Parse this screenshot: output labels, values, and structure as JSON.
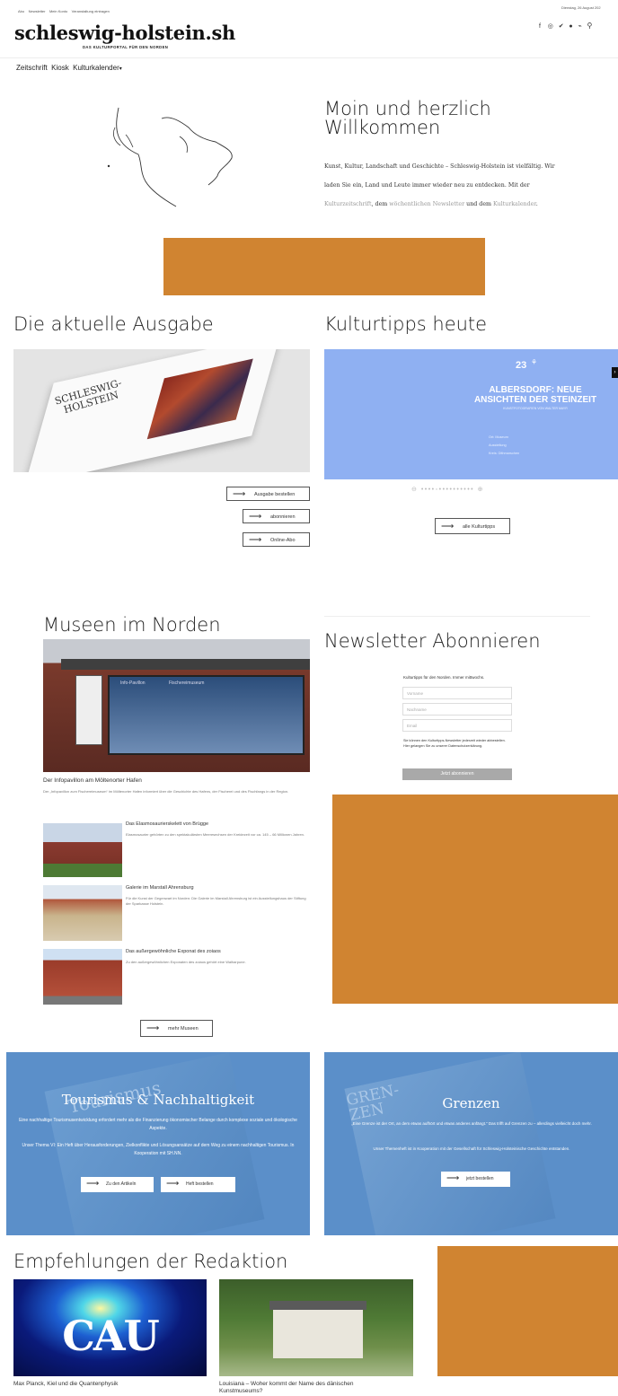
{
  "topbar": {
    "links": [
      "Abo",
      "Newsletter",
      "Mein Konto",
      "Veranstaltung eintragen"
    ],
    "date": "Dienstag, 26 August 202"
  },
  "header": {
    "logo": "schleswig-holstein.sh",
    "tagline": "DAS KULTURPORTAL FÜR DEN NORDEN",
    "social_icons": [
      "facebook-icon",
      "instagram-icon",
      "twitter-icon",
      "podcast-icon",
      "rss-icon",
      "search-icon"
    ]
  },
  "nav": {
    "items": [
      "Zeitschrift",
      "Kiosk",
      "Kulturkalender"
    ]
  },
  "welcome": {
    "title_line1": "Moin und herzlich",
    "title_line2": "Willkommen",
    "text1": "Kunst, Kultur, Landschaft und Geschichte – Schleswig-Holstein ist vielfältig. Wir",
    "text2": "laden Sie ein, Land und Leute immer wieder neu zu entdecken. Mit der",
    "link1": "Kulturzeitschrift",
    "sep1": ", dem ",
    "link2": "wöchentlichen Newsletter",
    "sep2": " und dem ",
    "link3": "Kulturkalender",
    "end": "."
  },
  "ausgabe": {
    "heading": "Die aktuelle Ausgabe",
    "magazine_title": "SCHLESWIG-HOLSTEIN",
    "buttons": [
      "Ausgabe bestellen",
      "abonnieren",
      "Online-Abo"
    ]
  },
  "kulturtipps": {
    "heading": "Kulturtipps heute",
    "day": "23",
    "headline1": "ALBERSDORF: NEUE",
    "headline2": "ANSICHTEN DER STEINZEIT",
    "sub": "KUNSTFOTOGRAFIEN VON WALTER MAYR",
    "meta1": "Ort: Museum",
    "meta2": "Ausstellung",
    "meta3": "Kreis: Dithmarschen",
    "button": "alle Kulturtipps",
    "accent": "#8fb0f2"
  },
  "museen": {
    "heading": "Museen im Norden",
    "photo_labels": [
      "Info-Pavillon",
      "Fischereimuseum"
    ],
    "main_title": "Der Infopavillon am Möltenorter Hafen",
    "main_text": "Der „Infopavillon zum Fischereimuseum“ im Möltenorter Hafen informiert über die Geschichte des Hafens, der Fischerei und des Fischfangs in der Region.",
    "items": [
      {
        "title": "Das Elasmosaurierskelett von Brügge",
        "text": "Elasmosaurier gehörten zu den spektakulärsten Meeresechsen der Kreidezeit vor ca. 145 – 66 Millionen Jahren."
      },
      {
        "title": "Galerie im Marstall Ahrensburg",
        "text": "Für die Kunst der Gegenwart im Norden: Die Galerie im Marstall Ahrensburg ist ein Ausstellungshaus der Stiftung der Sparkasse Holstein."
      },
      {
        "title": "Das außergewöhnliche Exponat des zoiaos",
        "text": "Zu den außergewöhnlichen Exponaten des zoiaos gehört eine Walharpune."
      }
    ],
    "button": "mehr Museen"
  },
  "newsletter": {
    "heading": "Newsletter Abonnieren",
    "intro": "Kulturtipps für den Norden. Immer mittwochs.",
    "fields": [
      "Vorname",
      "Nachname",
      "Email"
    ],
    "legal": "Sie können den Kulturtipps-Newsletter jederzeit wieder abbestellen. Hier gelangen Sie zu unserer Datenschutzerklärung.",
    "submit": "Jetzt abonnieren"
  },
  "tourismus": {
    "title": "Tourismus & Nachhaltigkeit",
    "text1": "Eine nachhaltige Tourismusentwicklung erfordert mehr als die Finanzierung ökonomischer Belange durch komplexe soziale und ökologische Aspekte.",
    "text2": "Unser Thema VI: Ein Heft über Herausforderungen, Zielkonflikte und Lösungsansätze auf dem Weg zu einem nachhaltigen Tourismus. In Kooperation mit SH.NN.",
    "buttons": [
      "Zu den Artikeln",
      "Heft bestellen"
    ],
    "cover_word": "Tourismus"
  },
  "grenzen": {
    "title": "Grenzen",
    "text1": "„Eine Grenze ist der Ort, an dem etwas aufhört und etwas anderes anfängt.“ Das trifft auf Grenzen zu – allerdings vielleicht doch mehr.",
    "text2": "Unser Themenheft ist in Kooperation mit der Gesellschaft für Schleswig-Holsteinische Geschichte entstanden.",
    "button": "jetzt bestellen",
    "cover_word": "GREN-ZEN"
  },
  "empfehlungen": {
    "heading": "Empfehlungen der Redaktion",
    "cards": [
      {
        "logo": "CAU",
        "caption": "Max Planck, Kiel und die Quantenphysik"
      },
      {
        "caption_line1": "Louisiana – Woher kommt der Name des dänischen",
        "caption_line2": "Kunstmuseums?"
      }
    ]
  },
  "colors": {
    "ad_orange": "#d08431",
    "promo_blue": "#5b8fc9"
  }
}
